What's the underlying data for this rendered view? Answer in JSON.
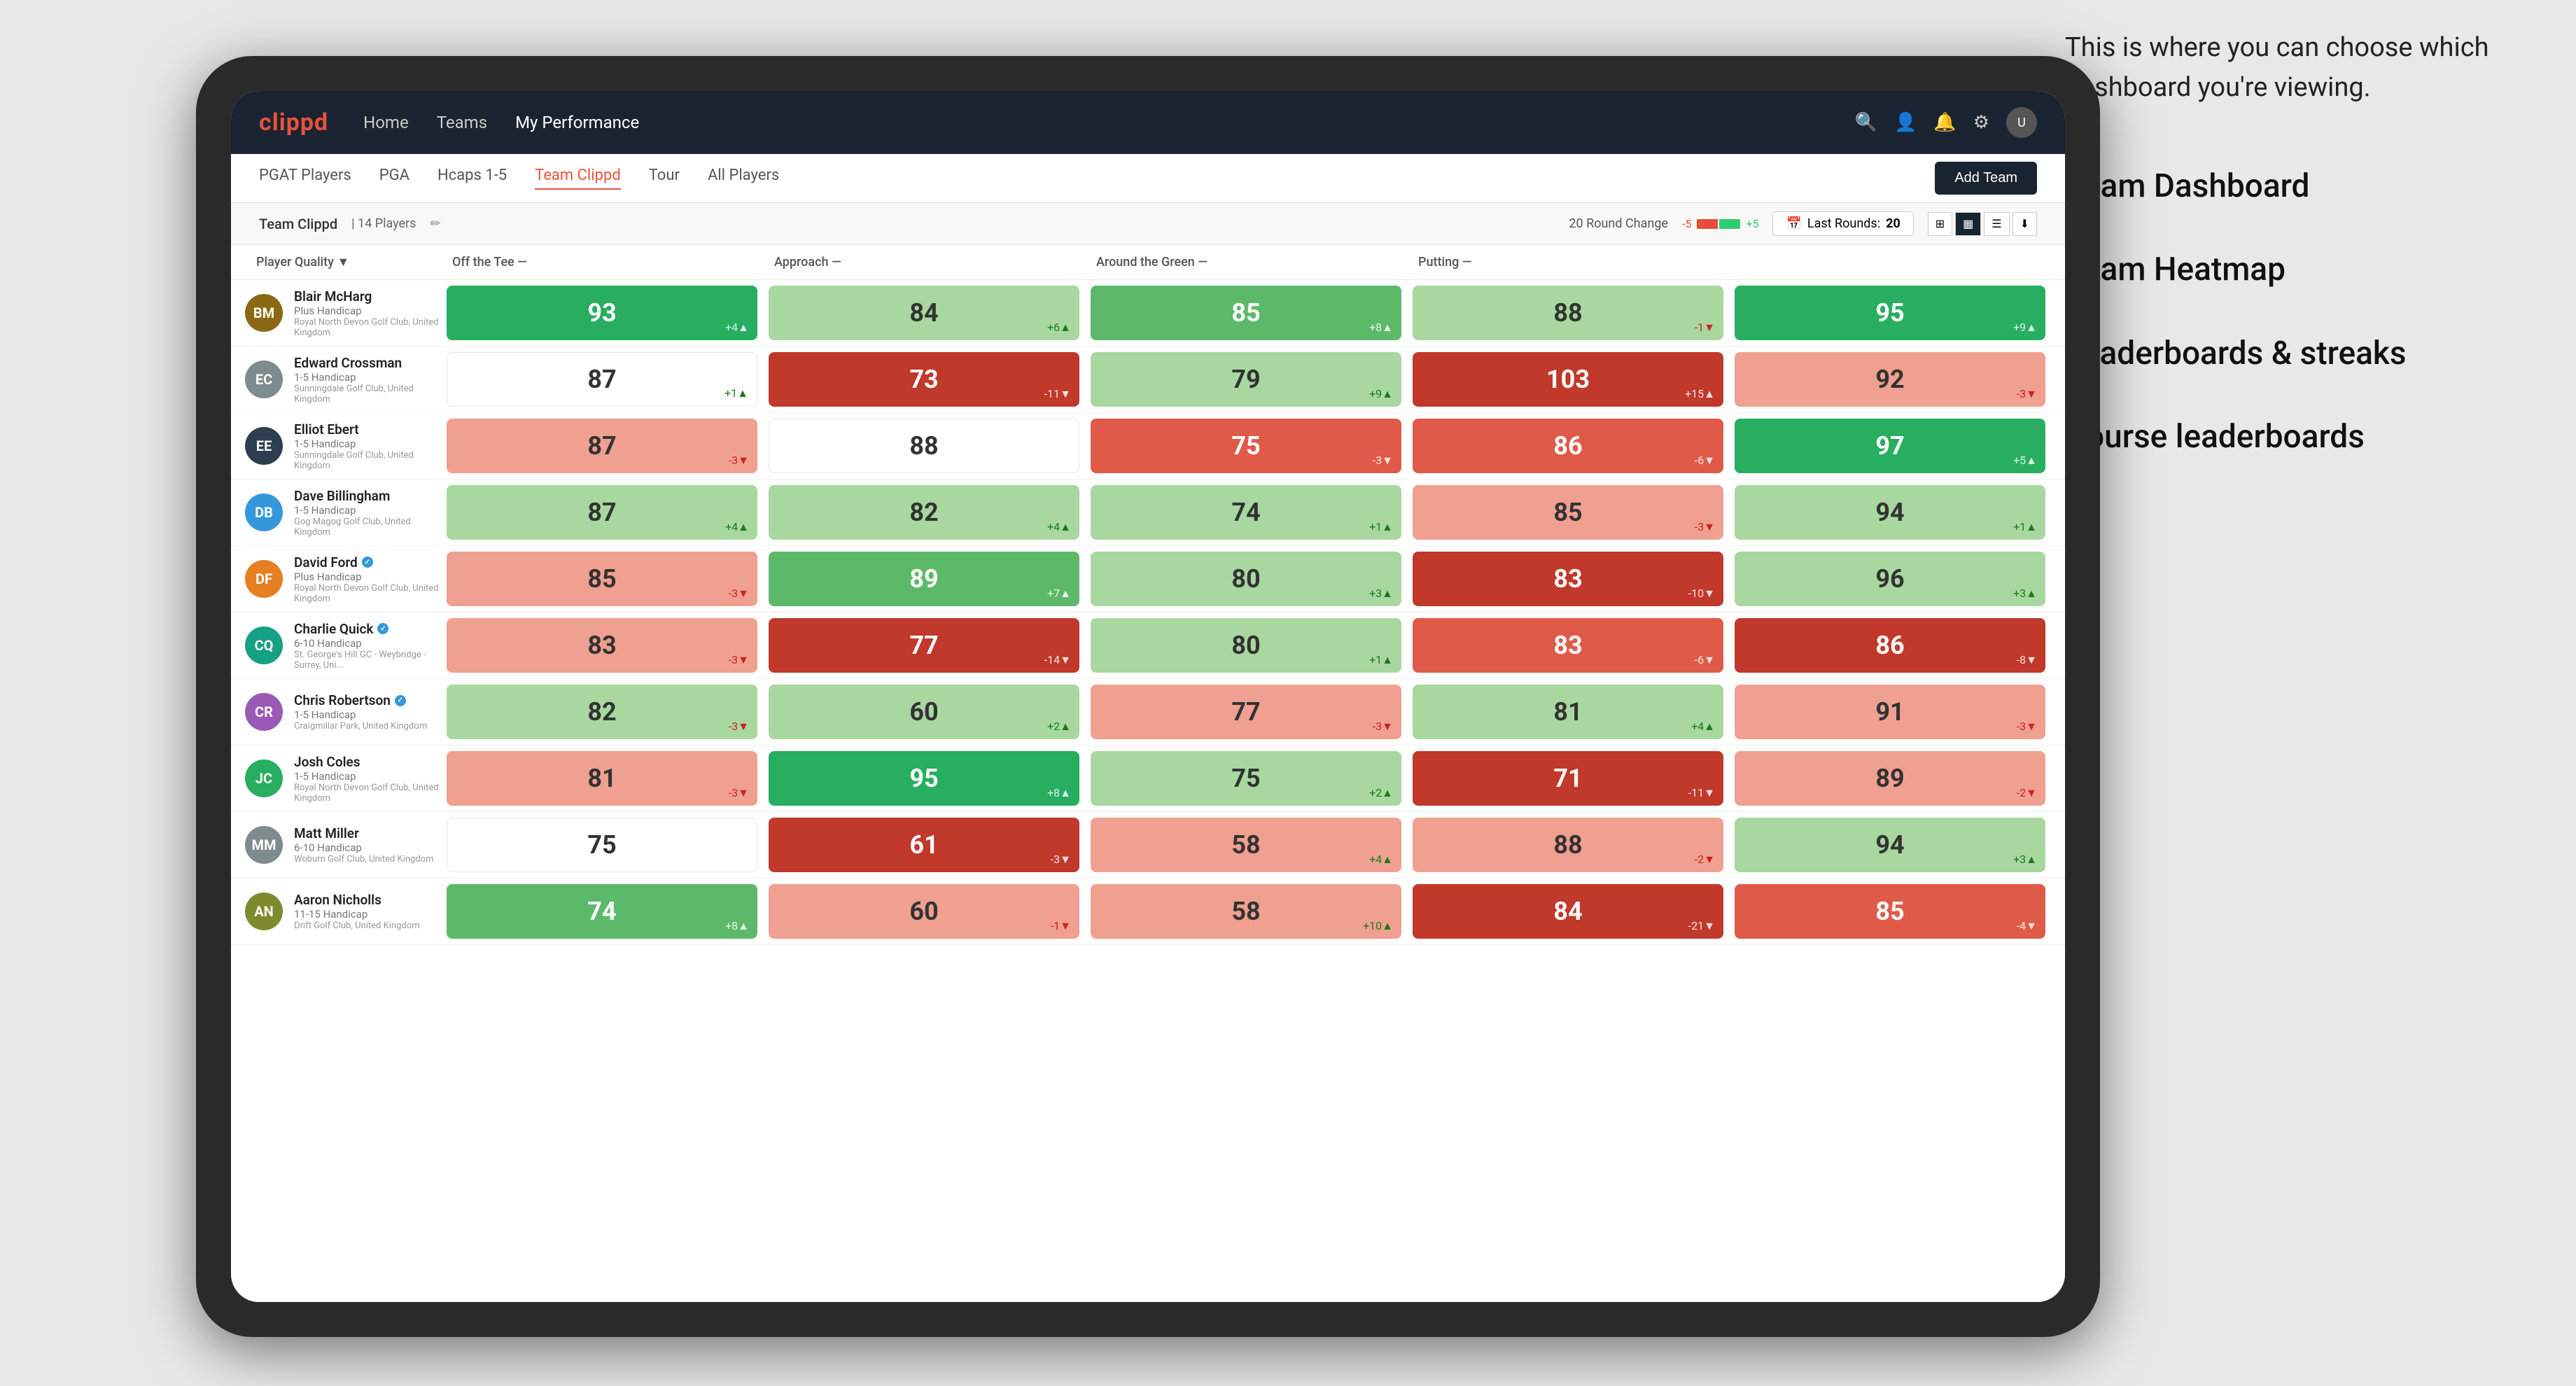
{
  "annotation": {
    "intro_text": "This is where you can choose which dashboard you're viewing.",
    "items": [
      "Team Dashboard",
      "Team Heatmap",
      "Leaderboards & streaks",
      "Course leaderboards"
    ]
  },
  "navbar": {
    "brand": "clippd",
    "links": [
      "Home",
      "Teams",
      "My Performance"
    ],
    "active_link": "My Performance"
  },
  "subnav": {
    "links": [
      "PGAT Players",
      "PGA",
      "Hcaps 1-5",
      "Team Clippd",
      "Tour",
      "All Players"
    ],
    "active_link": "Team Clippd",
    "add_team_label": "Add Team"
  },
  "team_header": {
    "team_name": "Team Clippd",
    "separator": "|",
    "player_count": "14 Players",
    "round_change_label": "20 Round Change",
    "change_neg": "-5",
    "change_pos": "+5",
    "last_rounds_label": "Last Rounds:",
    "last_rounds_value": "20"
  },
  "columns": {
    "player": "Player Quality ▼",
    "off_tee": "Off the Tee —",
    "approach": "Approach —",
    "around_green": "Around the Green —",
    "putting": "Putting —"
  },
  "players": [
    {
      "name": "Blair McHarg",
      "handicap": "Plus Handicap",
      "club": "Royal North Devon Golf Club, United Kingdom",
      "avatar_color": "av-brown",
      "initials": "BM",
      "stats": {
        "quality": {
          "value": 93,
          "change": "+4",
          "dir": "up",
          "color": "cell-green-dark"
        },
        "off_tee": {
          "value": 84,
          "change": "+6",
          "dir": "up",
          "color": "cell-green-light"
        },
        "approach": {
          "value": 85,
          "change": "+8",
          "dir": "up",
          "color": "cell-green-med"
        },
        "around_green": {
          "value": 88,
          "change": "-1",
          "dir": "down",
          "color": "cell-green-light"
        },
        "putting": {
          "value": 95,
          "change": "+9",
          "dir": "up",
          "color": "cell-green-dark"
        }
      }
    },
    {
      "name": "Edward Crossman",
      "handicap": "1-5 Handicap",
      "club": "Sunningdale Golf Club, United Kingdom",
      "avatar_color": "av-gray",
      "initials": "EC",
      "stats": {
        "quality": {
          "value": 87,
          "change": "+1",
          "dir": "up",
          "color": "cell-white"
        },
        "off_tee": {
          "value": 73,
          "change": "-11",
          "dir": "down",
          "color": "cell-red-dark"
        },
        "approach": {
          "value": 79,
          "change": "+9",
          "dir": "up",
          "color": "cell-green-light"
        },
        "around_green": {
          "value": 103,
          "change": "+15",
          "dir": "up",
          "color": "cell-red-dark"
        },
        "putting": {
          "value": 92,
          "change": "-3",
          "dir": "down",
          "color": "cell-red-light"
        }
      }
    },
    {
      "name": "Elliot Ebert",
      "handicap": "1-5 Handicap",
      "club": "Sunningdale Golf Club, United Kingdom",
      "avatar_color": "av-darkblue",
      "initials": "EE",
      "stats": {
        "quality": {
          "value": 87,
          "change": "-3",
          "dir": "down",
          "color": "cell-red-light"
        },
        "off_tee": {
          "value": 88,
          "change": "",
          "dir": "neutral",
          "color": "cell-white"
        },
        "approach": {
          "value": 75,
          "change": "-3",
          "dir": "down",
          "color": "cell-red-med"
        },
        "around_green": {
          "value": 86,
          "change": "-6",
          "dir": "down",
          "color": "cell-red-med"
        },
        "putting": {
          "value": 97,
          "change": "+5",
          "dir": "up",
          "color": "cell-green-dark"
        }
      }
    },
    {
      "name": "Dave Billingham",
      "handicap": "1-5 Handicap",
      "club": "Gog Magog Golf Club, United Kingdom",
      "avatar_color": "av-blue",
      "initials": "DB",
      "stats": {
        "quality": {
          "value": 87,
          "change": "+4",
          "dir": "up",
          "color": "cell-green-light"
        },
        "off_tee": {
          "value": 82,
          "change": "+4",
          "dir": "up",
          "color": "cell-green-light"
        },
        "approach": {
          "value": 74,
          "change": "+1",
          "dir": "up",
          "color": "cell-green-light"
        },
        "around_green": {
          "value": 85,
          "change": "-3",
          "dir": "down",
          "color": "cell-red-light"
        },
        "putting": {
          "value": 94,
          "change": "+1",
          "dir": "up",
          "color": "cell-green-light"
        }
      }
    },
    {
      "name": "David Ford",
      "handicap": "Plus Handicap",
      "club": "Royal North Devon Golf Club, United Kingdom",
      "avatar_color": "av-orange",
      "initials": "DF",
      "verified": true,
      "stats": {
        "quality": {
          "value": 85,
          "change": "-3",
          "dir": "down",
          "color": "cell-red-light"
        },
        "off_tee": {
          "value": 89,
          "change": "+7",
          "dir": "up",
          "color": "cell-green-med"
        },
        "approach": {
          "value": 80,
          "change": "+3",
          "dir": "up",
          "color": "cell-green-light"
        },
        "around_green": {
          "value": 83,
          "change": "-10",
          "dir": "down",
          "color": "cell-red-dark"
        },
        "putting": {
          "value": 96,
          "change": "+3",
          "dir": "up",
          "color": "cell-green-light"
        }
      }
    },
    {
      "name": "Charlie Quick",
      "handicap": "6-10 Handicap",
      "club": "St. George's Hill GC - Weybridge - Surrey, Uni...",
      "avatar_color": "av-teal",
      "initials": "CQ",
      "verified": true,
      "stats": {
        "quality": {
          "value": 83,
          "change": "-3",
          "dir": "down",
          "color": "cell-red-light"
        },
        "off_tee": {
          "value": 77,
          "change": "-14",
          "dir": "down",
          "color": "cell-red-dark"
        },
        "approach": {
          "value": 80,
          "change": "+1",
          "dir": "up",
          "color": "cell-green-light"
        },
        "around_green": {
          "value": 83,
          "change": "-6",
          "dir": "down",
          "color": "cell-red-med"
        },
        "putting": {
          "value": 86,
          "change": "-8",
          "dir": "down",
          "color": "cell-red-dark"
        }
      }
    },
    {
      "name": "Chris Robertson",
      "handicap": "1-5 Handicap",
      "club": "Craigmillar Park, United Kingdom",
      "avatar_color": "av-purple",
      "initials": "CR",
      "verified": true,
      "stats": {
        "quality": {
          "value": 82,
          "change": "-3",
          "dir": "down",
          "color": "cell-green-light"
        },
        "off_tee": {
          "value": 60,
          "change": "+2",
          "dir": "up",
          "color": "cell-green-light"
        },
        "approach": {
          "value": 77,
          "change": "-3",
          "dir": "down",
          "color": "cell-red-light"
        },
        "around_green": {
          "value": 81,
          "change": "+4",
          "dir": "up",
          "color": "cell-green-light"
        },
        "putting": {
          "value": 91,
          "change": "-3",
          "dir": "down",
          "color": "cell-red-light"
        }
      }
    },
    {
      "name": "Josh Coles",
      "handicap": "1-5 Handicap",
      "club": "Royal North Devon Golf Club, United Kingdom",
      "avatar_color": "av-green",
      "initials": "JC",
      "stats": {
        "quality": {
          "value": 81,
          "change": "-3",
          "dir": "down",
          "color": "cell-red-light"
        },
        "off_tee": {
          "value": 95,
          "change": "+8",
          "dir": "up",
          "color": "cell-green-dark"
        },
        "approach": {
          "value": 75,
          "change": "+2",
          "dir": "up",
          "color": "cell-green-light"
        },
        "around_green": {
          "value": 71,
          "change": "-11",
          "dir": "down",
          "color": "cell-red-dark"
        },
        "putting": {
          "value": 89,
          "change": "-2",
          "dir": "down",
          "color": "cell-red-light"
        }
      }
    },
    {
      "name": "Matt Miller",
      "handicap": "6-10 Handicap",
      "club": "Woburn Golf Club, United Kingdom",
      "avatar_color": "av-gray",
      "initials": "MM",
      "stats": {
        "quality": {
          "value": 75,
          "change": "",
          "dir": "neutral",
          "color": "cell-white"
        },
        "off_tee": {
          "value": 61,
          "change": "-3",
          "dir": "down",
          "color": "cell-red-dark"
        },
        "approach": {
          "value": 58,
          "change": "+4",
          "dir": "up",
          "color": "cell-red-light"
        },
        "around_green": {
          "value": 88,
          "change": "-2",
          "dir": "down",
          "color": "cell-red-light"
        },
        "putting": {
          "value": 94,
          "change": "+3",
          "dir": "up",
          "color": "cell-green-light"
        }
      }
    },
    {
      "name": "Aaron Nicholls",
      "handicap": "11-15 Handicap",
      "club": "Drift Golf Club, United Kingdom",
      "avatar_color": "av-olive",
      "initials": "AN",
      "stats": {
        "quality": {
          "value": 74,
          "change": "+8",
          "dir": "up",
          "color": "cell-green-med"
        },
        "off_tee": {
          "value": 60,
          "change": "-1",
          "dir": "down",
          "color": "cell-red-light"
        },
        "approach": {
          "value": 58,
          "change": "+10",
          "dir": "up",
          "color": "cell-red-light"
        },
        "around_green": {
          "value": 84,
          "change": "-21",
          "dir": "down",
          "color": "cell-red-dark"
        },
        "putting": {
          "value": 85,
          "change": "-4",
          "dir": "down",
          "color": "cell-red-med"
        }
      }
    }
  ]
}
